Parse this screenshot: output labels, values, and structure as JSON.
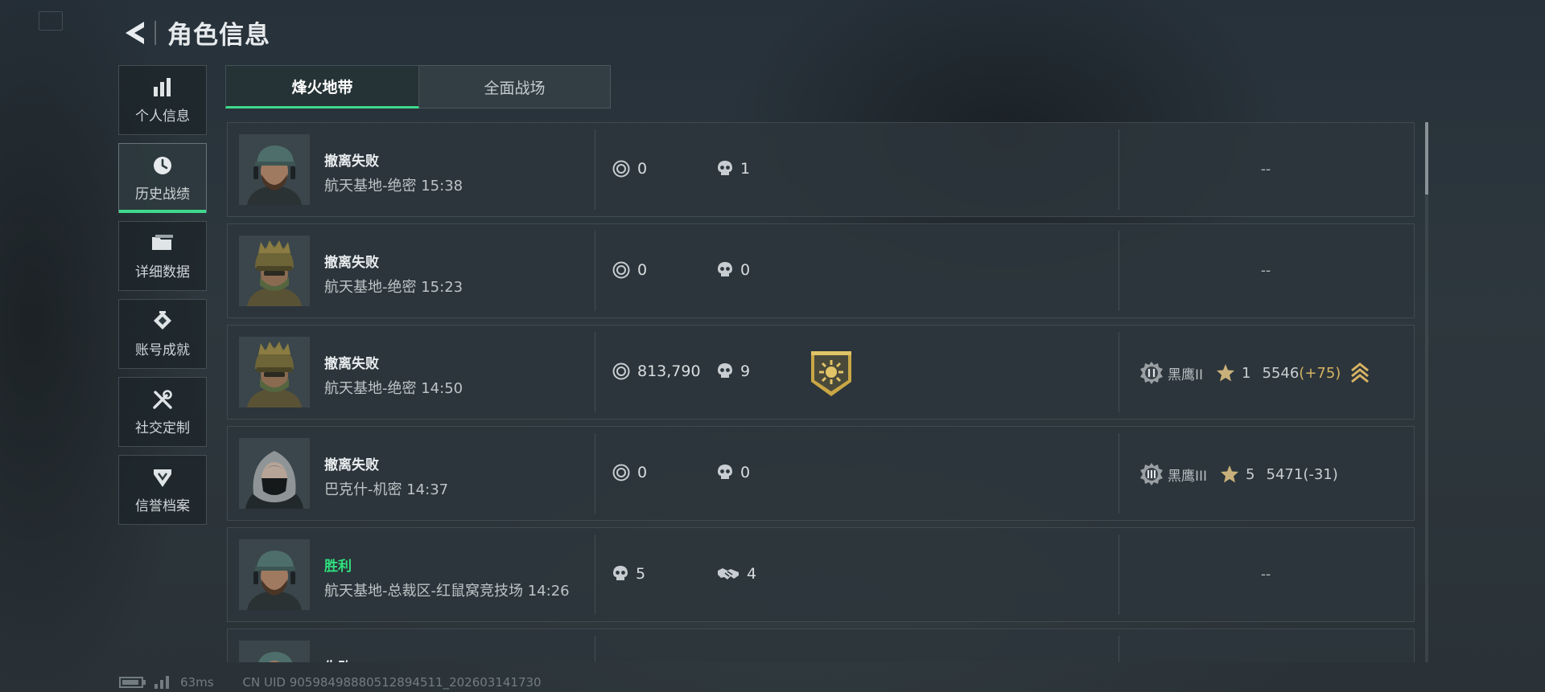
{
  "header": {
    "title": "角色信息"
  },
  "sidebar": {
    "items": [
      {
        "label": "个人信息",
        "icon": "bar-chart-icon"
      },
      {
        "label": "历史战绩",
        "icon": "clock-icon"
      },
      {
        "label": "详细数据",
        "icon": "folder-icon"
      },
      {
        "label": "账号成就",
        "icon": "achievement-icon"
      },
      {
        "label": "社交定制",
        "icon": "tools-icon"
      },
      {
        "label": "信誉档案",
        "icon": "shield-badge-icon"
      }
    ],
    "active_index": 1
  },
  "tabs": [
    {
      "label": "烽火地带"
    },
    {
      "label": "全面战场"
    }
  ],
  "records": [
    {
      "result": "撤离失败",
      "map": "航天基地-绝密",
      "time": "15:38",
      "stat_a": "0",
      "stat_b": "1",
      "rank_text": "--"
    },
    {
      "result": "撤离失败",
      "map": "航天基地-绝密",
      "time": "15:23",
      "stat_a": "0",
      "stat_b": "0",
      "rank_text": "--"
    },
    {
      "result": "撤离失败",
      "map": "航天基地-绝密",
      "time": "14:50",
      "stat_a": "813,790",
      "stat_b": "9",
      "rank": {
        "tier": "黑鹰II",
        "stars": "1",
        "score": "5546",
        "delta": "(+75)"
      }
    },
    {
      "result": "撤离失败",
      "map": "巴克什-机密",
      "time": "14:37",
      "stat_a": "0",
      "stat_b": "0",
      "rank": {
        "tier": "黑鹰III",
        "stars": "5",
        "score": "5471",
        "delta": "(-31)"
      }
    },
    {
      "result": "胜利",
      "map": "航天基地-总裁区-红鼠窝竞技场",
      "time": "14:26",
      "stat_a": "5",
      "stat_b": "4",
      "rank_text": "--"
    },
    {
      "result": "失败"
    }
  ],
  "footer": {
    "ping": "63ms",
    "uid": "CN UID 90598498880512894511_202603141730"
  },
  "colors": {
    "accent_green": "#3fd98b",
    "win_green": "#2fe07f",
    "delta_gold": "#d7b364",
    "medal_gold": "#c9a745"
  }
}
